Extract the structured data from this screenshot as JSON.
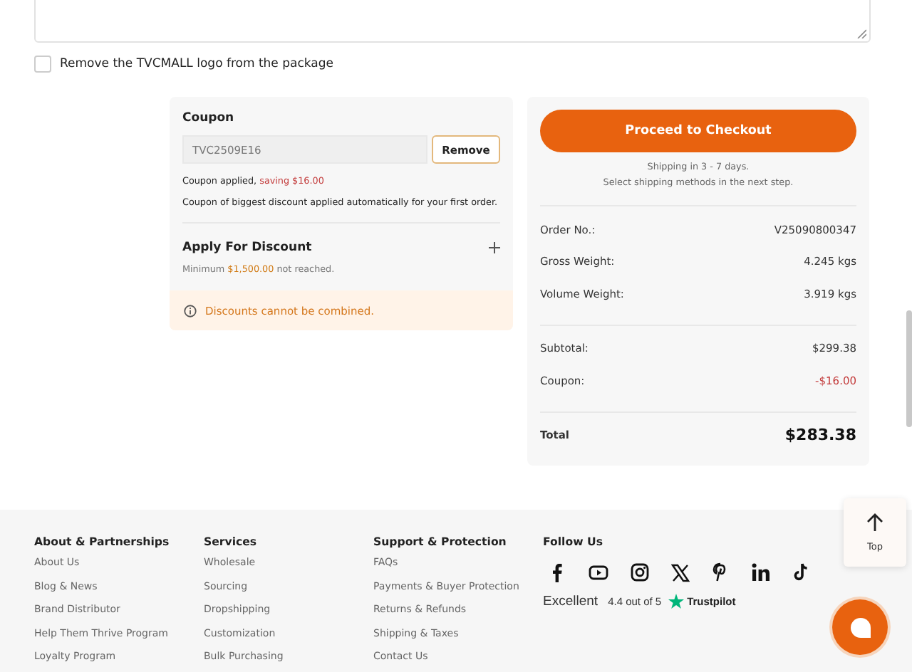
{
  "remove_logo": {
    "label": "Remove the TVCMALL logo from the package",
    "checked": false
  },
  "coupon": {
    "title": "Coupon",
    "code": "TVC2509E16",
    "button": "Remove",
    "applied_prefix": "Coupon applied,",
    "applied_saving": "saving $16.00",
    "note": "Coupon of biggest discount applied automatically for your first order."
  },
  "discount": {
    "title": "Apply For Discount",
    "expanded": false,
    "min_prefix": "Minimum",
    "min_amount": "$1,500.00",
    "min_suffix": "not reached.",
    "warning": "Discounts cannot be combined."
  },
  "checkout": {
    "button": "Proceed to Checkout",
    "shipping_line_1": "Shipping in 3 - 7 days.",
    "shipping_line_2": "Select shipping methods in the next step.",
    "info": [
      {
        "label": "Order No.:",
        "value": "V25090800347"
      },
      {
        "label": "Gross Weight:",
        "value": "4.245 kgs"
      },
      {
        "label": "Volume Weight:",
        "value": "3.919 kgs"
      }
    ],
    "amounts": [
      {
        "label": "Subtotal:",
        "value": "$299.38",
        "kind": "plain"
      },
      {
        "label": "Coupon:",
        "value": "-$16.00",
        "kind": "discount"
      }
    ],
    "total_label": "Total",
    "total_value": "$283.38"
  },
  "footer": {
    "columns": [
      {
        "title": "About & Partnerships",
        "links": [
          "About Us",
          "Blog & News",
          "Brand Distributor",
          "Help Them Thrive Program",
          "Loyalty Program"
        ]
      },
      {
        "title": "Services",
        "links": [
          "Wholesale",
          "Sourcing",
          "Dropshipping",
          "Customization",
          "Bulk Purchasing"
        ]
      },
      {
        "title": "Support & Protection",
        "links": [
          "FAQs",
          "Payments & Buyer Protection",
          "Returns & Refunds",
          "Shipping & Taxes",
          "Contact Us"
        ]
      }
    ],
    "follow": {
      "title": "Follow Us",
      "socials": [
        {
          "kind": "facebook"
        },
        {
          "kind": "youtube"
        },
        {
          "kind": "instagram"
        },
        {
          "kind": "x"
        },
        {
          "kind": "pinterest"
        },
        {
          "kind": "linkedin"
        },
        {
          "kind": "tiktok"
        }
      ]
    },
    "rating": {
      "word": "Excellent",
      "score": "4.4 out of 5",
      "brand": "Trustpilot"
    }
  },
  "top_button": "Top"
}
